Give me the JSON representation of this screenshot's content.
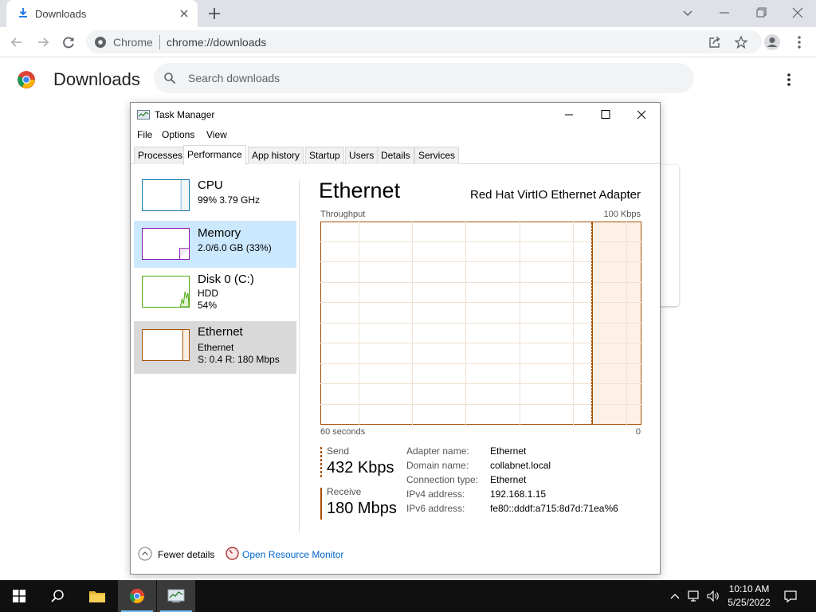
{
  "browser": {
    "tab": {
      "title": "Downloads",
      "icon": "download-icon"
    },
    "omnibox": {
      "site_label": "Chrome",
      "url": "chrome://downloads"
    }
  },
  "downloads": {
    "title": "Downloads",
    "search": {
      "placeholder": "Search downloads",
      "value": ""
    }
  },
  "task_manager": {
    "window_title": "Task Manager",
    "menu": [
      "File",
      "Options",
      "View"
    ],
    "tabs": [
      "Processes",
      "Performance",
      "App history",
      "Startup",
      "Users",
      "Details",
      "Services"
    ],
    "active_tab": "Performance",
    "perf_items": [
      {
        "name": "CPU",
        "lines": [
          "99%  3.79 GHz"
        ]
      },
      {
        "name": "Memory",
        "lines": [
          "2.0/6.0 GB (33%)"
        ]
      },
      {
        "name": "Disk 0 (C:)",
        "lines": [
          "HDD",
          "54%"
        ]
      },
      {
        "name": "Ethernet",
        "lines": [
          "Ethernet",
          "S: 0.4  R: 180 Mbps"
        ]
      }
    ],
    "detail": {
      "title": "Ethernet",
      "adapter": "Red Hat VirtIO Ethernet Adapter",
      "throughput_label": "Throughput",
      "max_label": "100 Kbps",
      "time_label": "60 seconds",
      "min_label": "0",
      "send": {
        "label": "Send",
        "value": "432 Kbps"
      },
      "receive": {
        "label": "Receive",
        "value": "180 Mbps"
      },
      "properties": [
        {
          "key": "Adapter name:",
          "value": "Ethernet"
        },
        {
          "key": "Domain name:",
          "value": "collabnet.local"
        },
        {
          "key": "Connection type:",
          "value": "Ethernet"
        },
        {
          "key": "IPv4 address:",
          "value": "192.168.1.15"
        },
        {
          "key": "IPv6 address:",
          "value": "fe80::dddf:a715:8d7d:71ea%6"
        }
      ]
    },
    "footer": {
      "fewer_details": "Fewer details",
      "resource_monitor": "Open Resource Monitor"
    }
  },
  "taskbar": {
    "apps": [
      "start-icon",
      "search-icon",
      "file-explorer-icon",
      "chrome-icon",
      "task-manager-icon"
    ],
    "clock": {
      "time": "10:10 AM",
      "date": "5/25/2022"
    }
  },
  "colors": {
    "ethernet_accent": "#a74f01",
    "memory_accent": "#8b12ae",
    "disk_accent": "#4da60c",
    "cpu_accent": "#1176ae",
    "selected_memory_bg": "#cce8ff",
    "selected_ethernet_bg": "#d9d9d9",
    "link": "#0066cc"
  }
}
